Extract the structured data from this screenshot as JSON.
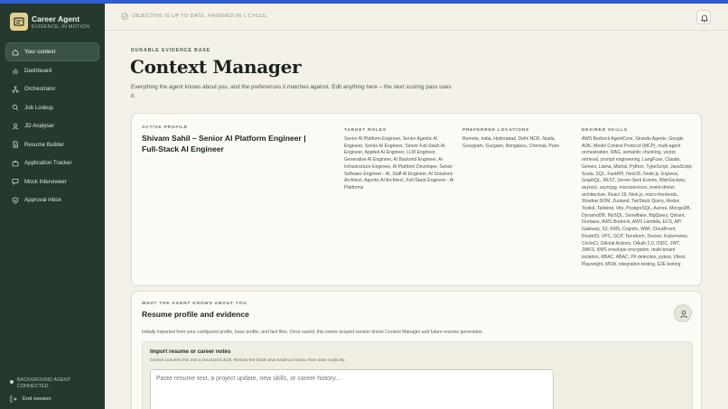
{
  "brand": {
    "title": "Career Agent",
    "subtitle": "EVIDENCE, IN MOTION"
  },
  "sidebar": {
    "items": [
      {
        "label": "Your context",
        "icon": "home-icon",
        "active": true
      },
      {
        "label": "Dashboard",
        "icon": "bar-chart-icon",
        "active": false
      },
      {
        "label": "Orchestrator",
        "icon": "network-icon",
        "active": false
      },
      {
        "label": "Job Lookup",
        "icon": "search-icon",
        "active": false
      },
      {
        "label": "JD Analyser",
        "icon": "user-icon",
        "active": false
      },
      {
        "label": "Resume Builder",
        "icon": "document-icon",
        "active": false
      },
      {
        "label": "Application Tracker",
        "icon": "briefcase-icon",
        "active": false
      },
      {
        "label": "Mock Interviewer",
        "icon": "chat-icon",
        "active": false
      },
      {
        "label": "Approval inbox",
        "icon": "shield-icon",
        "active": false
      }
    ],
    "status": "BACKGROUND AGENT CONNECTED",
    "end_session": "End session"
  },
  "header": {
    "objective": "OBJECTIVE IS UP TO DATE. FINISHED IN 1 CYCLE."
  },
  "page": {
    "eyebrow": "DURABLE EVIDENCE BASE",
    "title": "Context Manager",
    "description": "Everything the agent knows about you, and the preferences it matches against. Edit anything here – the next scoring pass uses it."
  },
  "profile": {
    "label": "ACTIVE PROFILE",
    "name": "Shivam Sahil – Senior AI Platform Engineer | Full-Stack AI Engineer",
    "target_roles_label": "TARGET ROLES",
    "target_roles": "Senior AI Platform Engineer, Senior Agentic AI Engineer, Senior AI Engineer, Senior Full-Stack AI Engineer, Applied AI Engineer, LLM Engineer, Generative AI Engineer, AI Backend Engineer, AI Infrastructure Engineer, AI Platform Developer, Senior Software Engineer - AI, Staff AI Engineer, AI Solutions Architect, Agentic AI Architect, Full-Stack Engineer - AI Platforms",
    "locations_label": "PREFERRED LOCATIONS",
    "locations": "Remote, India, Hyderabad, Delhi NCR, Noida, Gurugram, Gurgaon, Bengaluru, Chennai, Pune",
    "skills_label": "DESIRED SKILLS",
    "skills": "AWS Bedrock AgentCore, Strands Agents, Google ADK, Model Context Protocol (MCP), multi-agent orchestration, RAG, semantic chunking, vector retrieval, prompt engineering, LangFuse, Claude, Gemini, Llama, Mistral, Python, TypeScript, JavaScript, Scala, SQL, FastAPI, NestJS, Node.js, Express, GraphQL, REST, Server-Sent Events, WebSockets, asyncio, asyncpg, microservices, event-driven architecture, React 19, Next.js, micro-frontends, Shadow DOM, Zustand, TanStack Query, Redux Toolkit, Tailwind, Vite, PostgreSQL, Aurora, MongoDB, DynamoDB, MySQL, Snowflake, BigQuery, Qdrant, Firebase, AWS Bedrock, AWS Lambda, ECS, API Gateway, S3, KMS, Cognito, WAF, CloudFront, Route53, VPC, GCP, Terraform, Docker, Kubernetes, CircleCI, GitHub Actions, OAuth 2.0, OIDC, JWT, JWKS, KMS envelope encryption, multi-tenant isolation, RBAC, ABAC, PII detection, pytest, Vitest, Playwright, MSW, integration testing, E2E testing"
  },
  "evidence": {
    "label": "WHAT THE AGENT KNOWS ABOUT YOU",
    "title": "Resume profile and evidence",
    "description": "Initially imported from your configured profile, base profile, and fact files. Once saved, this owner-scoped version drives Context Manager and future resume generation.",
    "import_title": "Import resume or career notes",
    "import_hint": "Gemini converts this into a structured draft. Review the fields and evidence below, then save explicitly.",
    "import_placeholder": "Paste resume text, a project update, new skills, or career history..."
  }
}
